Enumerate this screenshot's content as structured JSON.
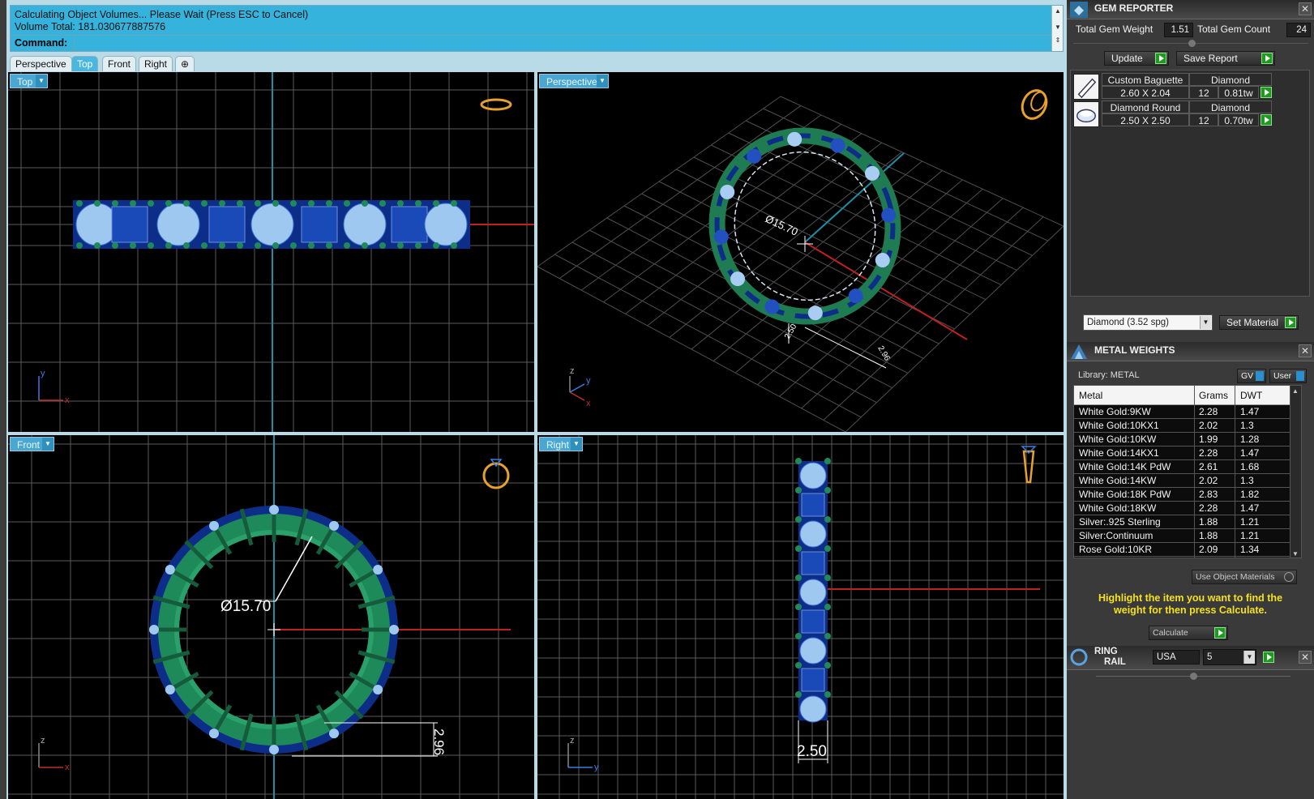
{
  "command": {
    "line1": "Calculating Object Volumes... Please Wait (Press ESC to Cancel)",
    "line2": "Volume Total: 181.030677887576",
    "label": "Command:",
    "input_value": ""
  },
  "tabs": [
    {
      "label": "Perspective",
      "active": false
    },
    {
      "label": "Top",
      "active": true
    },
    {
      "label": "Front",
      "active": false
    },
    {
      "label": "Right",
      "active": false
    },
    {
      "label": "⊕",
      "active": false
    }
  ],
  "viewports": {
    "top": {
      "label": "Top"
    },
    "perspective": {
      "label": "Perspective",
      "dimension": "Ø15.70",
      "small_dims": [
        "2.50",
        "2.96"
      ]
    },
    "front": {
      "label": "Front",
      "dimension": "Ø15.70",
      "height_dim": "2.96"
    },
    "right": {
      "label": "Right",
      "width_dim": "2.50"
    }
  },
  "axes": {
    "x": "x",
    "y": "y",
    "z": "z"
  },
  "gem_reporter": {
    "title": "GEM REPORTER",
    "total_weight_label": "Total Gem Weight",
    "total_weight": "1.51",
    "total_count_label": "Total Gem Count",
    "total_count": "24",
    "update_label": "Update",
    "save_label": "Save Report",
    "gems": [
      {
        "name": "Custom Baguette",
        "material": "Diamond",
        "size": "2.60 X 2.04",
        "count": "12",
        "weight": "0.81tw"
      },
      {
        "name": "Diamond Round",
        "material": "Diamond",
        "size": "2.50 X 2.50",
        "count": "12",
        "weight": "0.70tw"
      }
    ],
    "material_select": "Diamond   (3.52 spg)",
    "set_material_label": "Set Material"
  },
  "metal_weights": {
    "title": "METAL WEIGHTS",
    "library_label": "Library: METAL",
    "gv_label": "GV",
    "user_label": "User",
    "columns": [
      "Metal",
      "Grams",
      "DWT"
    ],
    "rows": [
      {
        "metal": "White Gold:9KW",
        "grams": "2.28",
        "dwt": "1.47"
      },
      {
        "metal": "White Gold:10KX1",
        "grams": "2.02",
        "dwt": "1.3"
      },
      {
        "metal": "White Gold:10KW",
        "grams": "1.99",
        "dwt": "1.28"
      },
      {
        "metal": "White Gold:14KX1",
        "grams": "2.28",
        "dwt": "1.47"
      },
      {
        "metal": "White Gold:14K PdW",
        "grams": "2.61",
        "dwt": "1.68"
      },
      {
        "metal": "White Gold:14KW",
        "grams": "2.02",
        "dwt": "1.3"
      },
      {
        "metal": "White Gold:18K PdW",
        "grams": "2.83",
        "dwt": "1.82"
      },
      {
        "metal": "White Gold:18KW",
        "grams": "2.28",
        "dwt": "1.47"
      },
      {
        "metal": "Silver:.925 Sterling",
        "grams": "1.88",
        "dwt": "1.21"
      },
      {
        "metal": "Silver:Continuum",
        "grams": "1.88",
        "dwt": "1.21"
      },
      {
        "metal": "Rose Gold:10KR",
        "grams": "2.09",
        "dwt": "1.34"
      }
    ],
    "use_object_materials": "Use Object Materials",
    "hint": "Highlight the item you want to find the weight for then press Calculate.",
    "calculate_label": "Calculate"
  },
  "ring_rail": {
    "title_line1": "RING",
    "title_line2": "RAIL",
    "region": "USA",
    "size": "5"
  }
}
